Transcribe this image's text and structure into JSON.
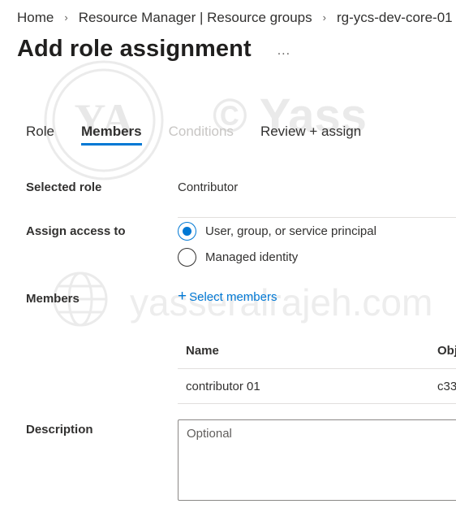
{
  "breadcrumb": {
    "items": [
      {
        "label": "Home"
      },
      {
        "label": "Resource Manager | Resource groups"
      },
      {
        "label": "rg-ycs-dev-core-01"
      }
    ],
    "separator": "›"
  },
  "page": {
    "title": "Add role assignment",
    "more_icon": "..."
  },
  "tabs": [
    {
      "label": "Role",
      "state": "normal"
    },
    {
      "label": "Members",
      "state": "active"
    },
    {
      "label": "Conditions",
      "state": "disabled"
    },
    {
      "label": "Review + assign",
      "state": "normal"
    }
  ],
  "form": {
    "selected_role_label": "Selected role",
    "selected_role_value": "Contributor",
    "assign_access_label": "Assign access to",
    "assign_options": [
      {
        "label": "User, group, or service principal",
        "checked": true
      },
      {
        "label": "Managed identity",
        "checked": false
      }
    ],
    "members_label": "Members",
    "select_members_icon": "+",
    "select_members_label": "Select members",
    "members_table": {
      "columns": [
        "Name",
        "Obj"
      ],
      "rows": [
        {
          "name": "contributor 01",
          "object": "c33"
        }
      ]
    },
    "description_label": "Description",
    "description_placeholder": "Optional",
    "description_value": ""
  },
  "watermark": {
    "initials": "YA",
    "text1": "©  Yass",
    "text2": "yasseralrajeh.com"
  },
  "colors": {
    "accent": "#0078d4",
    "text": "#323130",
    "disabled": "#c8c6c4",
    "divider": "#e1dfdd",
    "watermark": "#e8e8e8"
  }
}
